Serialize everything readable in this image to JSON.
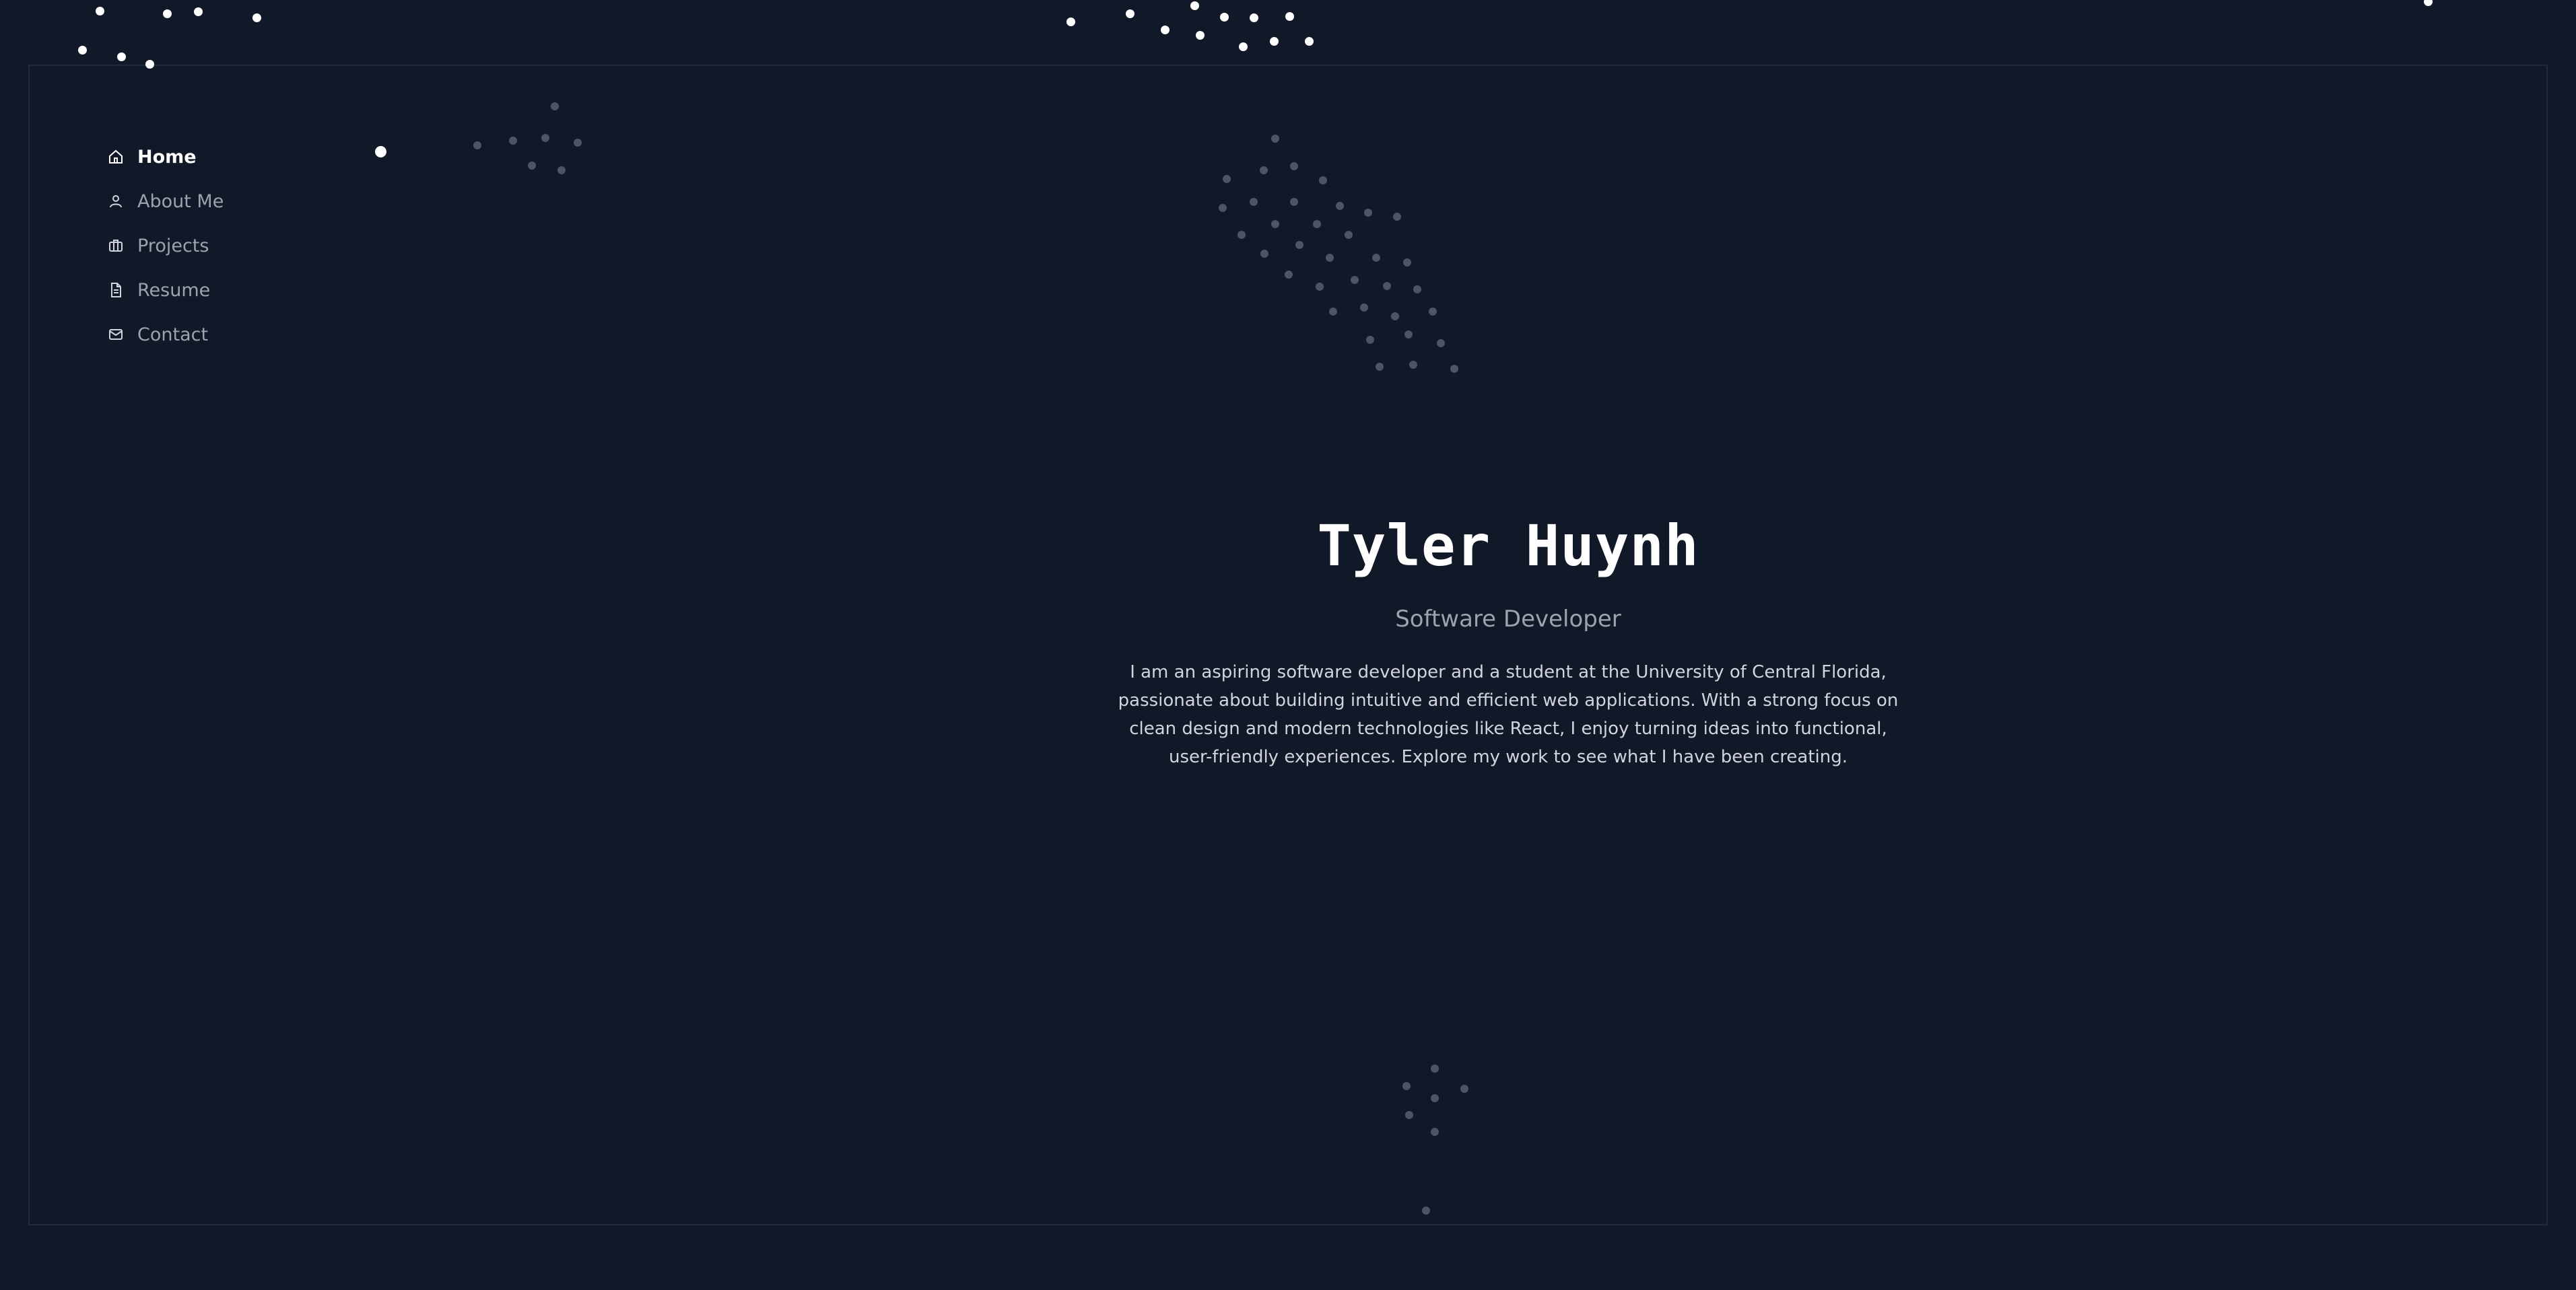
{
  "nav": {
    "items": [
      {
        "label": "Home",
        "icon": "home-icon",
        "active": true
      },
      {
        "label": "About Me",
        "icon": "user-icon",
        "active": false
      },
      {
        "label": "Projects",
        "icon": "briefcase-icon",
        "active": false
      },
      {
        "label": "Resume",
        "icon": "document-icon",
        "active": false
      },
      {
        "label": "Contact",
        "icon": "mail-icon",
        "active": false
      }
    ]
  },
  "hero": {
    "name": "Tyler Huynh",
    "role": "Software Developer",
    "bio": "I am an aspiring software developer and a student at the University of Central Florida, passionate about building intuitive and efficient web applications. With a strong focus on clean design and modern technologies like React, I enjoy turning ideas into functional, user-friendly experiences. Explore my work to see what I have been creating."
  },
  "colors": {
    "background": "#111827",
    "text_primary": "#ffffff",
    "text_muted": "#9ca3af",
    "particle_bright": "#ffffff",
    "particle_dim": "#4b5563"
  }
}
